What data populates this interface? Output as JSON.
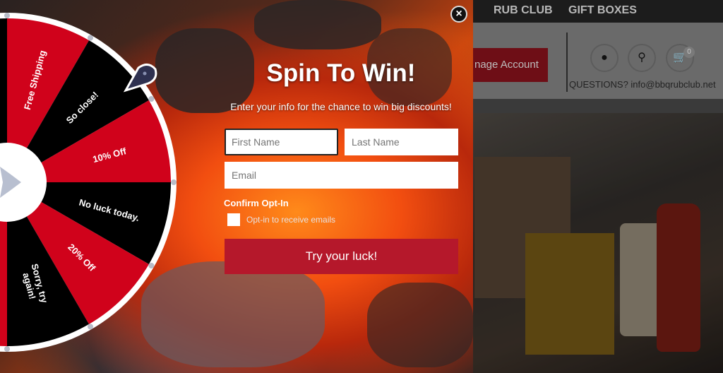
{
  "nav": {
    "items": [
      "RUB CLUB",
      "GIFT BOXES"
    ]
  },
  "header": {
    "manage_account": "nage Account",
    "questions": "QUESTIONS? info@bbqrubclub.net",
    "cart_count": "0"
  },
  "popup": {
    "title": "Spin To Win!",
    "subtitle": "Enter your info for the chance to win big discounts!",
    "first_name_placeholder": "First Name",
    "last_name_placeholder": "Last Name",
    "email_placeholder": "Email",
    "optin_heading": "Confirm Opt-In",
    "optin_label": "Opt-in to receive emails",
    "cta": "Try your luck!",
    "close": "×"
  },
  "wheel": {
    "segments": [
      {
        "label": "Free Shipping",
        "color": "#d0021b"
      },
      {
        "label": "So close!",
        "color": "#000000"
      },
      {
        "label": "10% Off",
        "color": "#d0021b"
      },
      {
        "label": "No luck today.",
        "color": "#000000"
      },
      {
        "label": "20% Off",
        "color": "#d0021b"
      },
      {
        "label": "Sorry, try again!",
        "color": "#000000"
      }
    ]
  },
  "colors": {
    "accent": "#b5182b",
    "wheel_red": "#d0021b",
    "pointer": "#2e3150"
  }
}
